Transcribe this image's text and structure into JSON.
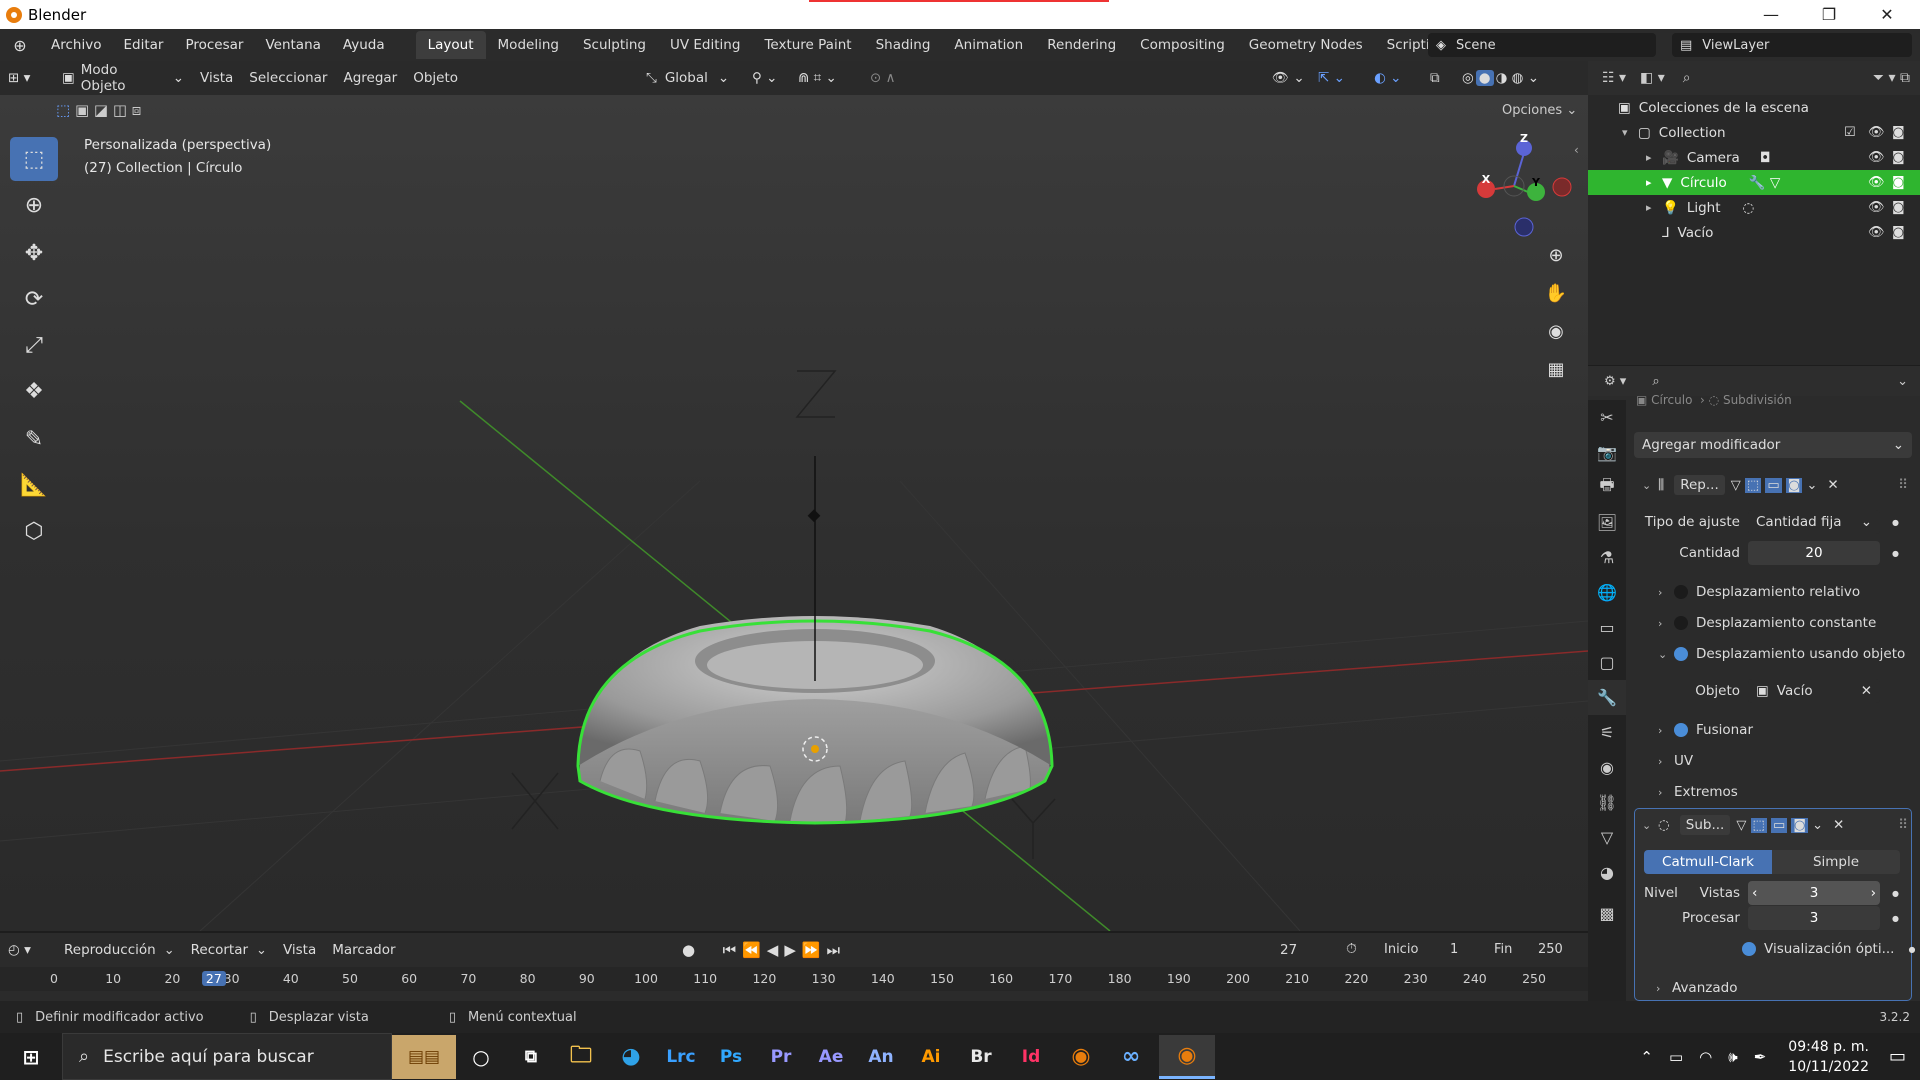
{
  "window": {
    "title": "Blender",
    "minimize": "—",
    "maximize": "❐",
    "close": "✕"
  },
  "menu": [
    "Archivo",
    "Editar",
    "Procesar",
    "Ventana",
    "Ayuda"
  ],
  "workspaces": [
    "Layout",
    "Modeling",
    "Sculpting",
    "UV Editing",
    "Texture Paint",
    "Shading",
    "Animation",
    "Rendering",
    "Compositing",
    "Geometry Nodes",
    "Scripting"
  ],
  "workspace_active": "Layout",
  "add_tab": "+",
  "scene": {
    "label": "Scene",
    "viewlayer": "ViewLayer"
  },
  "vp_header": {
    "mode": "Modo Objeto",
    "items": [
      "Vista",
      "Seleccionar",
      "Agregar",
      "Objeto"
    ],
    "transform": "Global",
    "options": "Opciones"
  },
  "viewport": {
    "info_line1": "Personalizada (perspectiva)",
    "info_line2": "(27) Collection | Círculo",
    "axis_x": "X",
    "axis_y": "Y",
    "axis_z": "Z"
  },
  "timeline": {
    "items": [
      "Reproducción",
      "Recortar",
      "Vista",
      "Marcador"
    ],
    "current_frame": "27",
    "start_label": "Inicio",
    "start": "1",
    "end_label": "Fin",
    "end": "250",
    "ticks": [
      "0",
      "10",
      "20",
      "27",
      "30",
      "40",
      "50",
      "60",
      "70",
      "80",
      "90",
      "100",
      "110",
      "120",
      "130",
      "140",
      "150",
      "160",
      "170",
      "180",
      "190",
      "200",
      "210",
      "220",
      "230",
      "240",
      "250"
    ]
  },
  "status": {
    "item1": "Definir modificador activo",
    "item2": "Desplazar vista",
    "item3": "Menú contextual",
    "version": "3.2.2"
  },
  "outliner": {
    "root": "Colecciones de la escena",
    "collection": "Collection",
    "items": [
      "Camera",
      "Círculo",
      "Light",
      "Vacío"
    ]
  },
  "properties": {
    "breadcrumb_obj": "Círculo",
    "breadcrumb_mod": "Subdivisión",
    "add_modifier": "Agregar modificador",
    "array": {
      "name": "Rep...",
      "fit_label": "Tipo de ajuste",
      "fit_value": "Cantidad fija",
      "count_label": "Cantidad",
      "count": "20",
      "relative": "Desplazamiento relativo",
      "constant": "Desplazamiento constante",
      "object_offset": "Desplazamiento usando objeto",
      "object_label": "Objeto",
      "object_value": "Vacío",
      "merge": "Fusionar",
      "uv": "UV",
      "caps": "Extremos"
    },
    "subsurf": {
      "name": "Sub...",
      "catmull": "Catmull-Clark",
      "simple": "Simple",
      "level_label": "Nivel",
      "views_label": "Vistas",
      "views": "3",
      "render_label": "Procesar",
      "render": "3",
      "optimal": "Visualización ópti...",
      "advanced": "Avanzado"
    }
  },
  "taskbar": {
    "search": "Escribe aquí para buscar",
    "time": "09:48 p. m.",
    "date": "10/11/2022",
    "apps": [
      "Lrc",
      "Ps",
      "Pr",
      "Ae",
      "An",
      "Ai",
      "Br",
      "Id"
    ]
  },
  "colors": {
    "accent": "#4772b3",
    "selected": "#2fb52f",
    "outline": "#38e038"
  }
}
